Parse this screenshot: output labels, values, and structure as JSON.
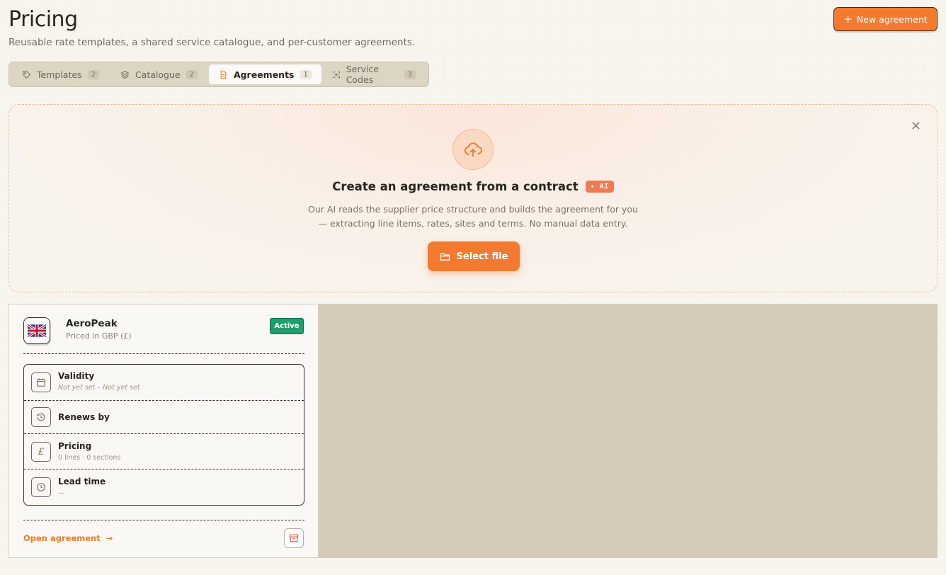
{
  "header": {
    "title": "Pricing",
    "subtitle": "Reusable rate templates, a shared service catalogue, and per-customer agreements.",
    "new_button_label": "New agreement"
  },
  "tabs": [
    {
      "label": "Templates",
      "count": "2",
      "icon": "tag-icon",
      "active": false
    },
    {
      "label": "Catalogue",
      "count": "2",
      "icon": "layers-icon",
      "active": false
    },
    {
      "label": "Agreements",
      "count": "1",
      "icon": "document-icon",
      "active": true
    },
    {
      "label": "Service Codes",
      "count": "3",
      "icon": "barcode-icon",
      "active": false
    }
  ],
  "upload": {
    "heading": "Create an agreement from a contract",
    "badge": "AI",
    "description_line1": "Our AI reads the supplier price structure and builds the agreement for you",
    "description_line2": "— extracting line items, rates, sites and terms. No manual data entry.",
    "button_label": "Select file"
  },
  "agreement": {
    "customer": "AeroPeak",
    "currency_note": "Priced in GBP (£)",
    "status": "Active",
    "details": [
      {
        "label": "Validity",
        "sub": "Not yet set – Not yet set",
        "icon": "calendar-icon"
      },
      {
        "label": "Renews by",
        "sub": "",
        "icon": "history-icon"
      },
      {
        "label": "Pricing",
        "sub": "0 lines · 0 sections",
        "icon": "pound-icon"
      },
      {
        "label": "Lead time",
        "sub": "—",
        "icon": "clock-icon"
      }
    ],
    "open_label": "Open agreement"
  },
  "colors": {
    "accent": "#f47a2f",
    "status_active": "#1f9f70",
    "ai_badge": "#ee7a54"
  }
}
